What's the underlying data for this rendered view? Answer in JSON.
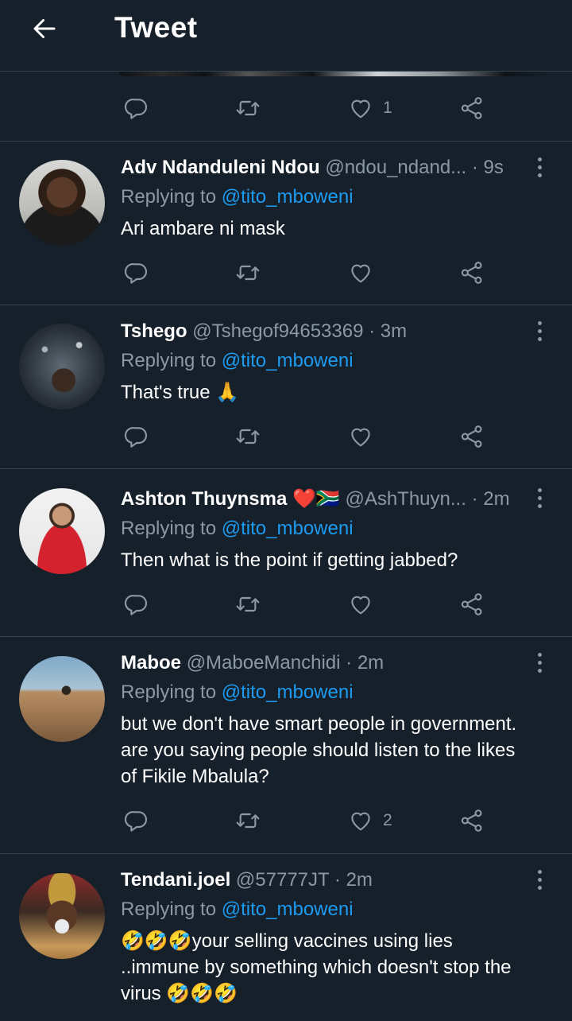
{
  "header": {
    "title": "Tweet",
    "back_icon": "arrow-left-icon"
  },
  "top_actions": {
    "likes": "1"
  },
  "replying_to_label": "Replying to",
  "tweets": [
    {
      "name": "Adv Ndanduleni Ndou",
      "handle": "@ndou_ndand...",
      "time": "· 9s",
      "mention": "@tito_mboweni",
      "text": "Ari ambare ni mask",
      "likes": ""
    },
    {
      "name": "Tshego",
      "handle": "@Tshegof94653369",
      "time": "· 3m",
      "mention": "@tito_mboweni",
      "text": "That's true 🙏",
      "likes": ""
    },
    {
      "name": "Ashton Thuynsma ❤️🇿🇦",
      "handle": "@AshThuyn...",
      "time": "· 2m",
      "mention": "@tito_mboweni",
      "text": "Then what is the point if getting jabbed?",
      "likes": ""
    },
    {
      "name": "Maboe",
      "handle": "@MaboeManchidi",
      "time": "· 2m",
      "mention": "@tito_mboweni",
      "text": "but we don't have smart people in government. are you saying people should listen to the likes of Fikile Mbalula?",
      "likes": "2"
    },
    {
      "name": "Tendani.joel",
      "handle": "@57777JT",
      "time": "· 2m",
      "mention": "@tito_mboweni",
      "text": "🤣🤣🤣your selling vaccines using lies ..immune by something which doesn't stop the virus 🤣🤣🤣",
      "likes": ""
    }
  ],
  "colors": {
    "background": "#15202b",
    "divider": "#38444d",
    "secondary_text": "#8b98a5",
    "link": "#1d9bf0"
  }
}
